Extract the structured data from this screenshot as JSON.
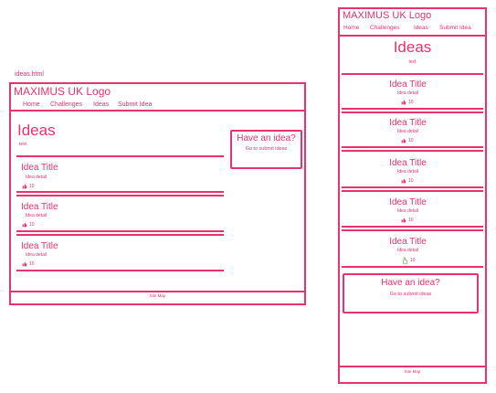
{
  "caption": "ideas.html",
  "desktop": {
    "logo": "MAXIMUS UK Logo",
    "nav": [
      "Home",
      "Challenges",
      "Ideas",
      "Submit Idea"
    ],
    "page_title": "Ideas",
    "intro_text": "text",
    "ideas": [
      {
        "title": "Idea Title",
        "detail": "Idea detail",
        "likes": "10"
      },
      {
        "title": "Idea Title",
        "detail": "Idea detail",
        "likes": "10"
      },
      {
        "title": "Idea Title",
        "detail": "Idea detail",
        "likes": "10"
      }
    ],
    "cta": {
      "heading": "Have an idea?",
      "link": "Go to submit ideas"
    },
    "footer": "Site Map"
  },
  "mobile": {
    "logo": "MAXIMUS UK Logo",
    "nav": [
      "Home",
      "Challenges",
      "Ideas",
      "Submit Idea"
    ],
    "page_title": "Ideas",
    "intro_text": "text",
    "ideas": [
      {
        "title": "Idea Title",
        "detail": "Idea detail",
        "likes": "10"
      },
      {
        "title": "Idea Title",
        "detail": "Idea detail",
        "likes": "10"
      },
      {
        "title": "Idea Title",
        "detail": "Idea detail",
        "likes": "10"
      },
      {
        "title": "Idea Title",
        "detail": "Idea detail",
        "likes": "10"
      },
      {
        "title": "Idea Title",
        "detail": "Idea detail",
        "likes": "10"
      }
    ],
    "cta": {
      "heading": "Have an idea?",
      "link": "Go to submit ideas"
    },
    "footer": "Site Map"
  },
  "colors": {
    "accent": "#e8336d"
  }
}
